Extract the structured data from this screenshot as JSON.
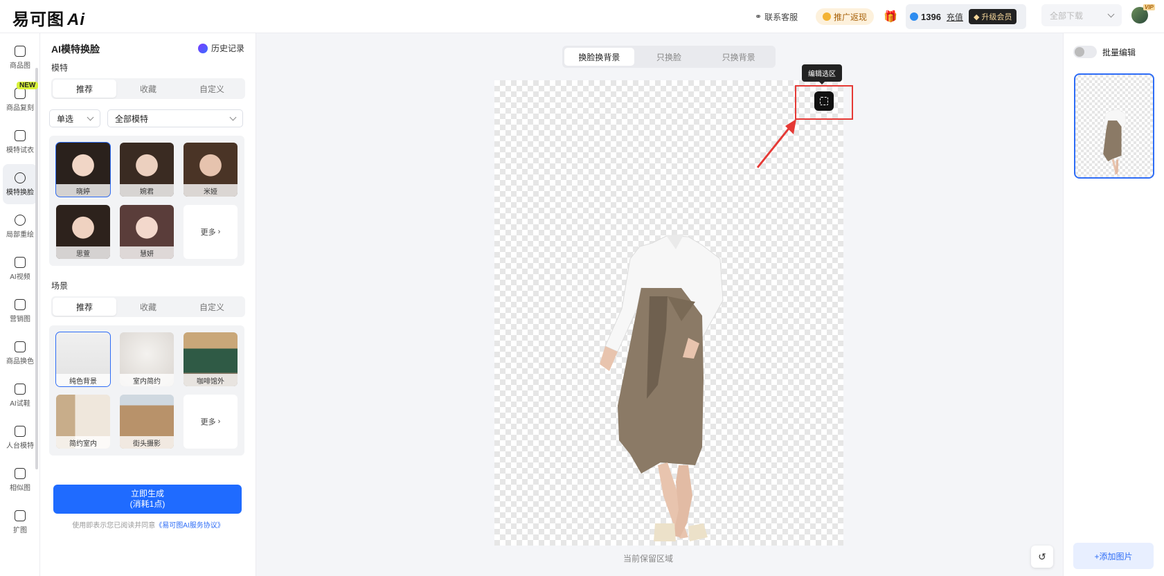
{
  "app": {
    "logo_text": "易可图",
    "logo_ai": "Ai"
  },
  "topbar": {
    "contact": "联系客服",
    "promo": "推广返现",
    "balance": "1396",
    "recharge": "充值",
    "upgrade": "升级会员",
    "download_all": "全部下载",
    "vip": "VIP"
  },
  "sidenav": {
    "new_badge": "NEW",
    "items": [
      {
        "label": "商品图",
        "icon": "product-icon"
      },
      {
        "label": "商品复刻",
        "icon": "copy-icon"
      },
      {
        "label": "模特试衣",
        "icon": "shirt-icon"
      },
      {
        "label": "模特换脸",
        "icon": "face-icon"
      },
      {
        "label": "局部重绘",
        "icon": "repaint-icon"
      },
      {
        "label": "AI视频",
        "icon": "video-icon"
      },
      {
        "label": "营销图",
        "icon": "marketing-icon"
      },
      {
        "label": "商品换色",
        "icon": "color-drop-icon"
      },
      {
        "label": "AI试鞋",
        "icon": "shoe-icon"
      },
      {
        "label": "人台模特",
        "icon": "mannequin-icon"
      },
      {
        "label": "相似图",
        "icon": "similar-icon"
      },
      {
        "label": "扩图",
        "icon": "expand-icon"
      }
    ]
  },
  "panel": {
    "title": "AI模特换脸",
    "history": "历史记录",
    "model_section": "模特",
    "model_tabs": [
      "推荐",
      "收藏",
      "自定义"
    ],
    "select_mode": "单选",
    "select_models": "全部模特",
    "models": [
      "晓婷",
      "婉君",
      "米娅",
      "思萱",
      "慧妍"
    ],
    "more": "更多",
    "scene_section": "场景",
    "scene_tabs": [
      "推荐",
      "收藏",
      "自定义"
    ],
    "scenes": [
      "纯色背景",
      "室内简约",
      "咖啡馆外",
      "简约室内",
      "街头摄影"
    ],
    "generate": "立即生成",
    "cost": "(消耗1点)",
    "agree_prefix": "使用即表示您已阅读并同意",
    "agree_link": "《易可图AI服务协议》"
  },
  "canvas": {
    "modes": [
      "换脸换背景",
      "只换脸",
      "只换背景"
    ],
    "tooltip": "编辑选区",
    "caption": "当前保留区域"
  },
  "right": {
    "batch_edit": "批量编辑",
    "add_image": "+添加图片"
  },
  "colors": {
    "accent": "#1f6bff",
    "highlight": "#e53935",
    "skirt": "#8b7a66"
  }
}
